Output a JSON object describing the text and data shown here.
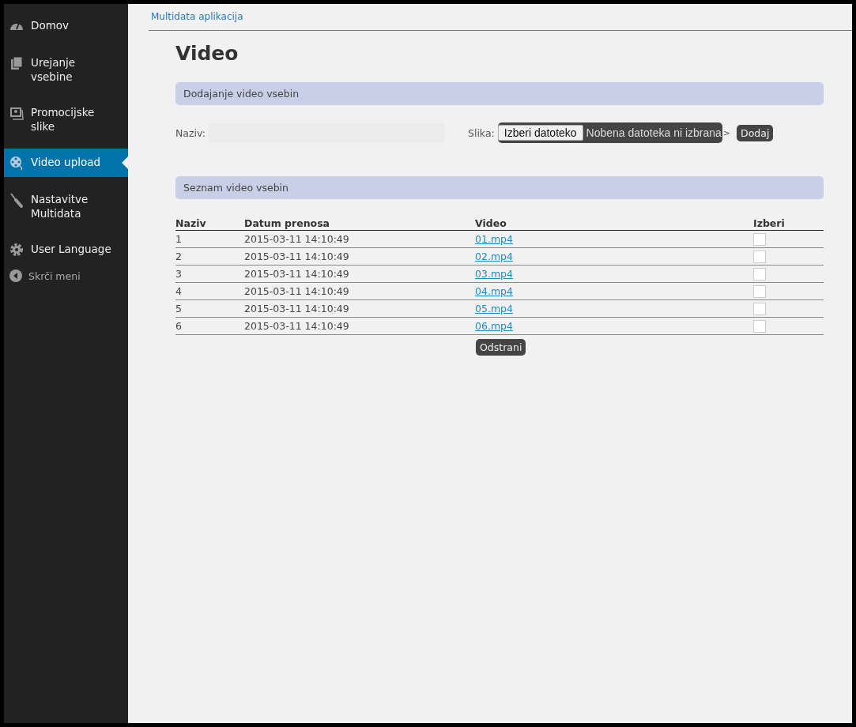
{
  "sidebar": {
    "items": [
      {
        "label": "Domov",
        "selected": false
      },
      {
        "label": "Urejanje vsebine",
        "selected": false
      },
      {
        "label": "Promocijske slike",
        "selected": false
      },
      {
        "label": "Video upload",
        "selected": true
      },
      {
        "label": "Nastavitve Multidata",
        "selected": false
      },
      {
        "label": "User Language",
        "selected": false
      }
    ],
    "collapse": "Skrči meni"
  },
  "breadcrumb": "Multidata aplikacija",
  "title": "Video",
  "add_section": {
    "heading": "Dodajanje video vsebin",
    "name_label": "Naziv:",
    "image_label": "Slika:",
    "file_button": "Izberi datoteko",
    "file_status": "Nobena datoteka ni izbrana",
    "stray_text": ">",
    "add_button": "Dodaj"
  },
  "list_section": {
    "heading": "Seznam video vsebin"
  },
  "table": {
    "columns": [
      "Naziv",
      "Datum prenosa",
      "Video",
      "Izberi"
    ],
    "rows": [
      {
        "name": "1",
        "date": "2015-03-11 14:10:49",
        "video": "01.mp4",
        "checked": false
      },
      {
        "name": "2",
        "date": "2015-03-11 14:10:49",
        "video": "02.mp4",
        "checked": false
      },
      {
        "name": "3",
        "date": "2015-03-11 14:10:49",
        "video": "03.mp4",
        "checked": false
      },
      {
        "name": "4",
        "date": "2015-03-11 14:10:49",
        "video": "04.mp4",
        "checked": false
      },
      {
        "name": "5",
        "date": "2015-03-11 14:10:49",
        "video": "05.mp4",
        "checked": false
      },
      {
        "name": "6",
        "date": "2015-03-11 14:10:49",
        "video": "06.mp4",
        "checked": false
      }
    ]
  },
  "remove_button": "Odstrani"
}
